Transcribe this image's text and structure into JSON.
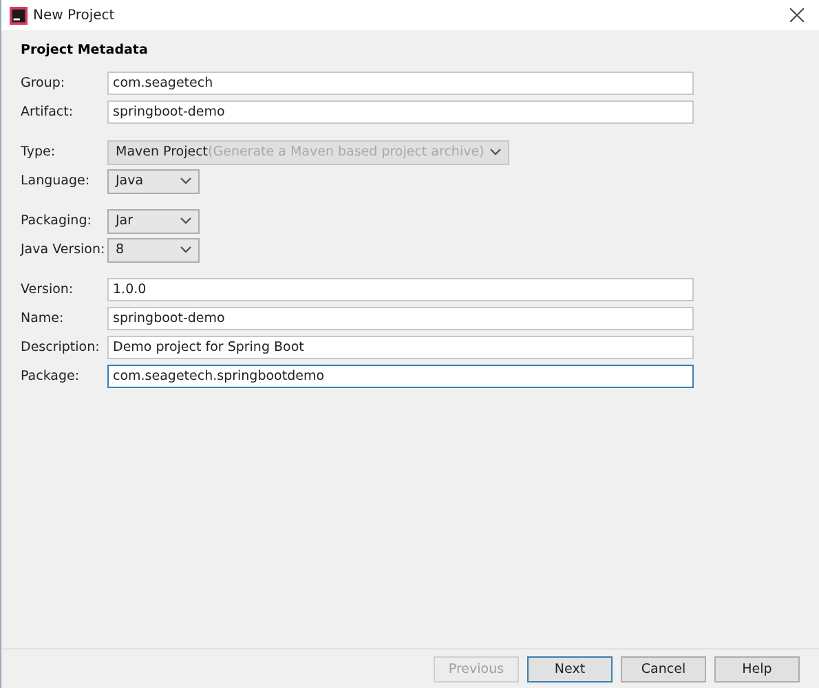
{
  "window": {
    "title": "New Project"
  },
  "section_title": "Project Metadata",
  "field_groups": [
    {
      "fields": [
        {
          "kind": "text",
          "label": "Group:",
          "value": "com.seagetech",
          "focused": false
        },
        {
          "kind": "text",
          "label": "Artifact:",
          "value": "springboot-demo",
          "focused": false
        }
      ]
    },
    {
      "fields": [
        {
          "kind": "select",
          "label": "Type:",
          "value": "Maven Project",
          "hint": "(Generate a Maven based project archive)",
          "disabled": true
        },
        {
          "kind": "select",
          "label": "Language:",
          "value": "Java",
          "disabled": false
        }
      ]
    },
    {
      "fields": [
        {
          "kind": "select",
          "label": "Packaging:",
          "value": "Jar",
          "disabled": false
        },
        {
          "kind": "select",
          "label": "Java Version:",
          "value": "8",
          "disabled": false
        }
      ]
    },
    {
      "fields": [
        {
          "kind": "text",
          "label": "Version:",
          "value": "1.0.0",
          "focused": false
        },
        {
          "kind": "text",
          "label": "Name:",
          "value": "springboot-demo",
          "focused": false
        },
        {
          "kind": "text",
          "label": "Description:",
          "value": "Demo project for Spring Boot",
          "focused": false
        },
        {
          "kind": "text",
          "label": "Package:",
          "value": "com.seagetech.springbootdemo",
          "focused": true
        }
      ]
    }
  ],
  "buttons": [
    {
      "label": "Previous",
      "disabled": true,
      "default": false
    },
    {
      "label": "Next",
      "disabled": false,
      "default": true
    },
    {
      "label": "Cancel",
      "disabled": false,
      "default": false
    },
    {
      "label": "Help",
      "disabled": false,
      "default": false
    }
  ]
}
